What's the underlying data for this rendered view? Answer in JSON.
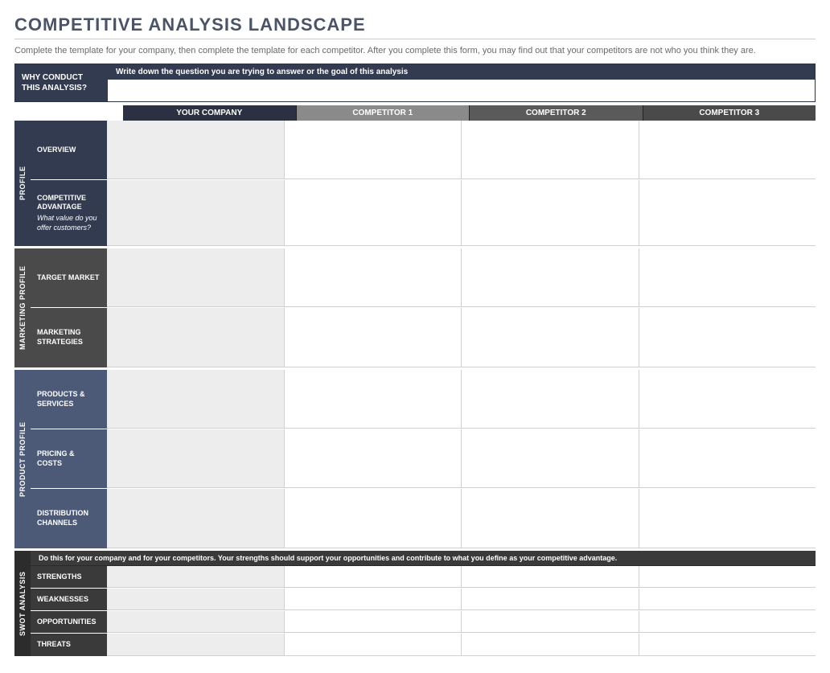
{
  "title": "COMPETITIVE ANALYSIS LANDSCAPE",
  "instructions": "Complete the template for your company, then complete the template for each competitor. After you complete this form, you may find out that your competitors are not who you think they are.",
  "why": {
    "label": "WHY CONDUCT THIS ANALYSIS?",
    "prompt": "Write down the question you are trying to answer or the goal of this analysis"
  },
  "columns": {
    "your": "YOUR COMPANY",
    "c1": "COMPETITOR 1",
    "c2": "COMPETITOR 2",
    "c3": "COMPETITOR 3"
  },
  "sections": {
    "profile": {
      "tab": "PROFILE",
      "rows": {
        "overview": {
          "label": "OVERVIEW"
        },
        "advantage": {
          "label": "COMPETITIVE ADVANTAGE",
          "sub": "What value do you offer customers?"
        }
      }
    },
    "marketing": {
      "tab": "MARKETING PROFILE",
      "rows": {
        "target": {
          "label": "TARGET MARKET"
        },
        "strategies": {
          "label": "MARKETING STRATEGIES"
        }
      }
    },
    "product": {
      "tab": "PRODUCT PROFILE",
      "rows": {
        "products": {
          "label": "PRODUCTS & SERVICES"
        },
        "pricing": {
          "label": "PRICING & COSTS"
        },
        "distribution": {
          "label": "DISTRIBUTION CHANNELS"
        }
      }
    },
    "swot": {
      "tab": "SWOT ANALYSIS",
      "note": "Do this for your company and for your competitors. Your strengths should support your opportunities and contribute to what you define as your competitive advantage.",
      "rows": {
        "strengths": {
          "label": "STRENGTHS"
        },
        "weaknesses": {
          "label": "WEAKNESSES"
        },
        "opportunities": {
          "label": "OPPORTUNITIES"
        },
        "threats": {
          "label": "THREATS"
        }
      }
    }
  }
}
